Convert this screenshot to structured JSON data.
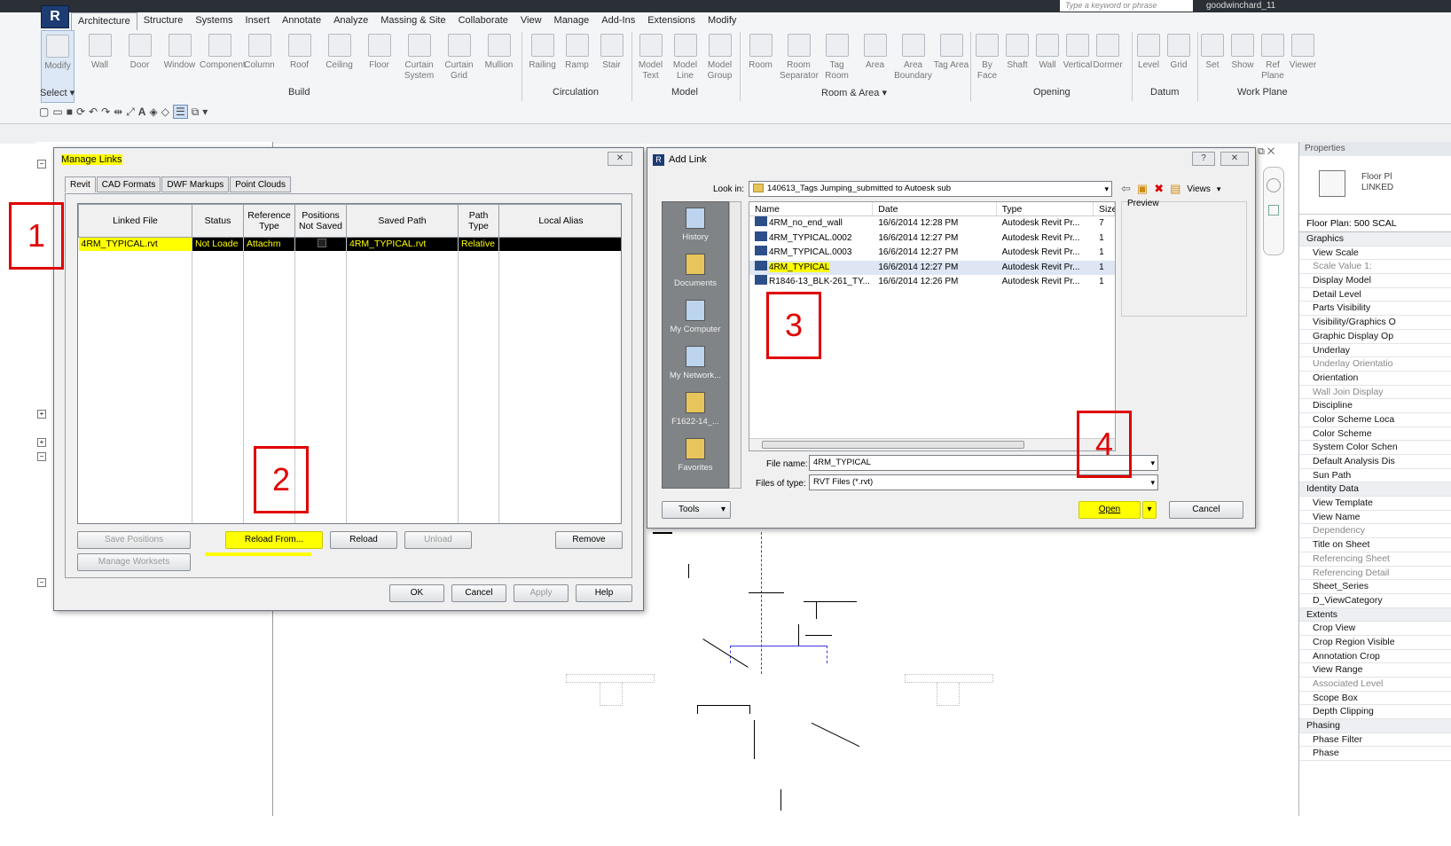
{
  "app": {
    "search_placeholder": "Type a keyword or phrase",
    "user": "goodwinchard_11"
  },
  "ribbon": {
    "tabs": [
      "Architecture",
      "Structure",
      "Systems",
      "Insert",
      "Annotate",
      "Analyze",
      "Massing & Site",
      "Collaborate",
      "View",
      "Manage",
      "Add-Ins",
      "Extensions",
      "Modify"
    ],
    "modify": "Modify",
    "select": "Select ▾",
    "build": [
      "Wall",
      "Door",
      "Window",
      "Component",
      "Column",
      "Roof",
      "Ceiling",
      "Floor",
      "Curtain System",
      "Curtain Grid",
      "Mullion"
    ],
    "circulation": [
      "Railing",
      "Ramp",
      "Stair"
    ],
    "model": [
      "Model Text",
      "Model Line",
      "Model Group"
    ],
    "room": [
      "Room",
      "Room Separator",
      "Tag Room",
      "Area",
      "Area Boundary",
      "Tag Area"
    ],
    "opening": [
      "By Face",
      "Shaft",
      "Wall",
      "Vertical",
      "Dormer"
    ],
    "datum": [
      "Level",
      "Grid"
    ],
    "workplane": [
      "Set",
      "Show",
      "Ref Plane",
      "Viewer"
    ],
    "panel_labels": {
      "build": "Build",
      "circulation": "Circulation",
      "model": "Model",
      "room": "Room & Area ▾",
      "opening": "Opening",
      "datum": "Datum",
      "workplane": "Work Plane"
    }
  },
  "manage_links": {
    "title": "Manage Links",
    "tabs": [
      "Revit",
      "CAD Formats",
      "DWF Markups",
      "Point Clouds"
    ],
    "headers": [
      "Linked File",
      "Status",
      "Reference Type",
      "Positions Not Saved",
      "Saved Path",
      "Path Type",
      "Local Alias"
    ],
    "row": {
      "file": "4RM_TYPICAL.rvt",
      "status": "Not Loade",
      "ref": "Attachm",
      "saved_path": "4RM_TYPICAL.rvt",
      "path_type": "Relative",
      "alias": ""
    },
    "buttons": {
      "save_positions": "Save Positions",
      "reload_from": "Reload From...",
      "reload": "Reload",
      "unload": "Unload",
      "remove": "Remove",
      "manage_worksets": "Manage Worksets",
      "ok": "OK",
      "cancel": "Cancel",
      "apply": "Apply",
      "help": "Help"
    }
  },
  "add_link": {
    "title": "Add Link",
    "look_in_label": "Look in:",
    "look_in_value": "140613_Tags Jumping_submitted to Autoesk sub",
    "views": "Views",
    "preview": "Preview",
    "places": [
      "History",
      "Documents",
      "My Computer",
      "My Network...",
      "F1622-14_...",
      "Favorites"
    ],
    "columns": [
      "Name",
      "Date",
      "Type",
      "Size"
    ],
    "files": [
      {
        "name": "4RM_no_end_wall",
        "date": "16/6/2014 12:28 PM",
        "type": "Autodesk Revit Pr...",
        "size": "7"
      },
      {
        "name": "4RM_TYPICAL.0002",
        "date": "16/6/2014 12:27 PM",
        "type": "Autodesk Revit Pr...",
        "size": "1"
      },
      {
        "name": "4RM_TYPICAL.0003",
        "date": "16/6/2014 12:27 PM",
        "type": "Autodesk Revit Pr...",
        "size": "1"
      },
      {
        "name": "4RM_TYPICAL",
        "date": "16/6/2014 12:27 PM",
        "type": "Autodesk Revit Pr...",
        "size": "1"
      },
      {
        "name": "R1846-13_BLK-261_TY...",
        "date": "16/6/2014 12:26 PM",
        "type": "Autodesk Revit Pr...",
        "size": "1"
      }
    ],
    "file_name_label": "File name:",
    "file_name_value": "4RM_TYPICAL",
    "file_type_label": "Files of type:",
    "file_type_value": "RVT Files  (*.rvt)",
    "tools": "Tools",
    "open": "Open",
    "cancel": "Cancel"
  },
  "properties": {
    "title": "Properties",
    "type_name": "Floor Pl",
    "type_sub": "LINKED",
    "selector": "Floor Plan: 500 SCAL",
    "rows": [
      {
        "t": "Graphics",
        "g": true
      },
      {
        "t": "View Scale"
      },
      {
        "t": "Scale Value    1:",
        "d": true
      },
      {
        "t": "Display Model"
      },
      {
        "t": "Detail Level"
      },
      {
        "t": "Parts Visibility"
      },
      {
        "t": "Visibility/Graphics O"
      },
      {
        "t": "Graphic Display Op"
      },
      {
        "t": "Underlay"
      },
      {
        "t": "Underlay Orientatio",
        "d": true
      },
      {
        "t": "Orientation"
      },
      {
        "t": "Wall Join Display",
        "d": true
      },
      {
        "t": "Discipline"
      },
      {
        "t": "Color Scheme Loca"
      },
      {
        "t": "Color Scheme"
      },
      {
        "t": "System Color Schen"
      },
      {
        "t": "Default Analysis Dis"
      },
      {
        "t": "Sun Path"
      },
      {
        "t": "Identity Data",
        "g": true
      },
      {
        "t": "View Template"
      },
      {
        "t": "View Name"
      },
      {
        "t": "Dependency",
        "d": true
      },
      {
        "t": "Title on Sheet"
      },
      {
        "t": "Referencing Sheet",
        "d": true
      },
      {
        "t": "Referencing Detail",
        "d": true
      },
      {
        "t": "Sheet_Series"
      },
      {
        "t": "D_ViewCategory"
      },
      {
        "t": "Extents",
        "g": true
      },
      {
        "t": "Crop View"
      },
      {
        "t": "Crop Region Visible"
      },
      {
        "t": "Annotation Crop"
      },
      {
        "t": "View Range"
      },
      {
        "t": "Associated Level",
        "d": true
      },
      {
        "t": "Scope Box"
      },
      {
        "t": "Depth Clipping"
      },
      {
        "t": "Phasing",
        "g": true
      },
      {
        "t": "Phase Filter"
      },
      {
        "t": "Phase"
      }
    ]
  },
  "markers": {
    "m1": "1",
    "m2": "2",
    "m3": "3",
    "m4": "4"
  },
  "colors": {
    "highlight": "#ffff00",
    "marker": "#e00000",
    "selection": "#000000"
  }
}
